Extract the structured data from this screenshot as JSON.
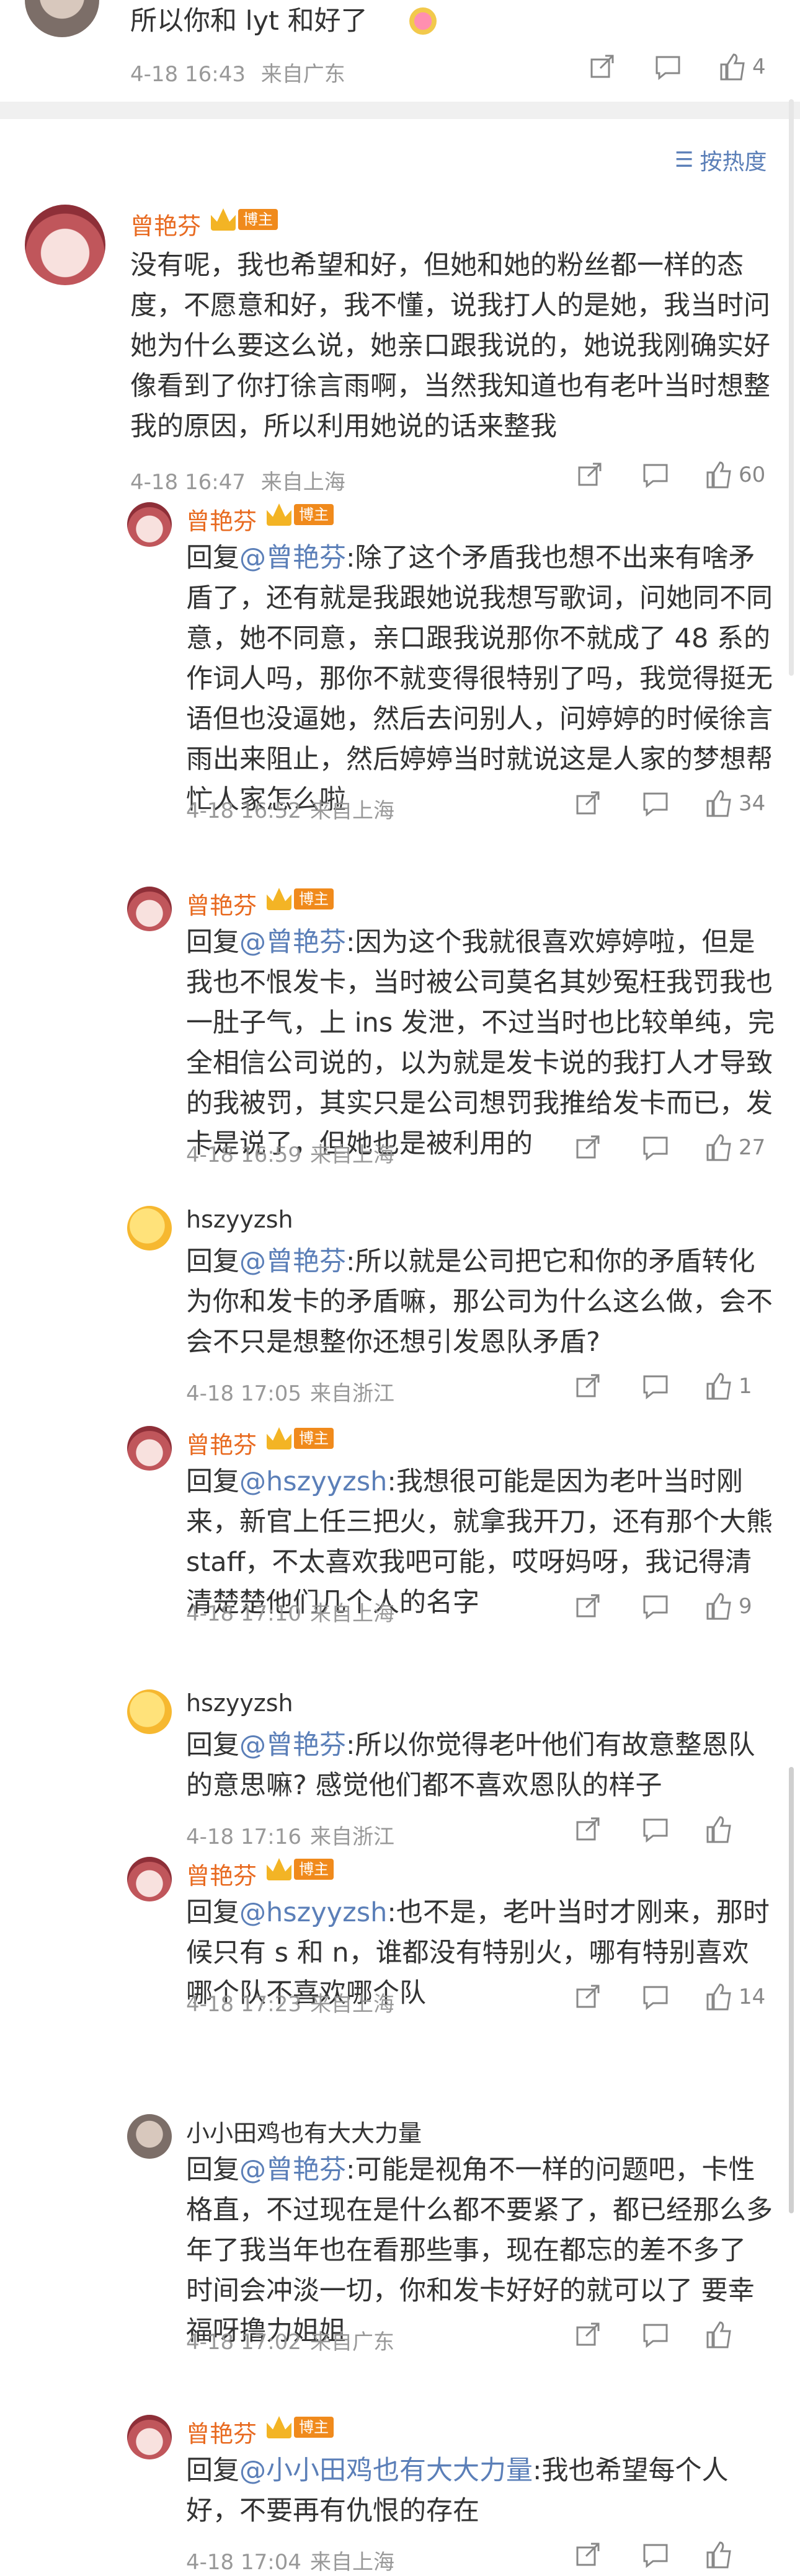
{
  "top_comment": {
    "text": "所以你和 lyt 和好了",
    "time": "4-18 16:43",
    "location": "来自广东",
    "likes": "4"
  },
  "sort": {
    "label": "按热度"
  },
  "badge_label": "博主",
  "main_comment": {
    "user": "曾艳芬",
    "text": "没有呢，我也希望和好，但她和她的粉丝都一样的态度，不愿意和好，我不懂，说我打人的是她，我当时问她为什么要这么说，她亲口跟我说的，她说我刚确实好像看到了你打徐言雨啊，当然我知道也有老叶当时想整我的原因，所以利用她说的话来整我",
    "time": "4-18 16:47",
    "location": "来自上海",
    "likes": "60"
  },
  "replies": [
    {
      "user": "曾艳芬",
      "is_author": true,
      "prefix": "回复",
      "mention": "@曾艳芬",
      "text": ":除了这个矛盾我也想不出来有啥矛盾了，还有就是我跟她说我想写歌词，问她同不同意，她不同意，亲口跟我说那你不就成了 48 系的作词人吗，那你不就变得很特别了吗，我觉得挺无语但也没逼她，然后去问别人，问婷婷的时候徐言雨出来阻止，然后婷婷当时就说这是人家的梦想帮忙人家怎么啦",
      "time": "4-18 16:52",
      "location": "来自上海",
      "likes": "34"
    },
    {
      "user": "曾艳芬",
      "is_author": true,
      "prefix": "回复",
      "mention": "@曾艳芬",
      "text": ":因为这个我就很喜欢婷婷啦，但是我也不恨发卡，当时被公司莫名其妙冤枉我罚我也一肚子气，上 ins 发泄，不过当时也比较单纯，完全相信公司说的，以为就是发卡说的我打人才导致的我被罚，其实只是公司想罚我推给发卡而已，发卡是说了，但她也是被利用的",
      "time": "4-18 16:59",
      "location": "来自上海",
      "likes": "27"
    },
    {
      "user": "hszyyzsh",
      "is_author": false,
      "prefix": "回复",
      "mention": "@曾艳芬",
      "text": ":所以就是公司把它和你的矛盾转化为你和发卡的矛盾嘛，那公司为什么这么做，会不会不只是想整你还想引发恩队矛盾?",
      "time": "4-18 17:05",
      "location": "来自浙江",
      "likes": "1"
    },
    {
      "user": "曾艳芬",
      "is_author": true,
      "prefix": "回复",
      "mention": "@hszyyzsh",
      "text": ":我想很可能是因为老叶当时刚来，新官上任三把火，就拿我开刀，还有那个大熊 staff，不太喜欢我吧可能，哎呀妈呀，我记得清清楚楚他们几个人的名字",
      "time": "4-18 17:10",
      "location": "来自上海",
      "likes": "9"
    },
    {
      "user": "hszyyzsh",
      "is_author": false,
      "prefix": "回复",
      "mention": "@曾艳芬",
      "text": ":所以你觉得老叶他们有故意整恩队的意思嘛? 感觉他们都不喜欢恩队的样子",
      "time": "4-18 17:16",
      "location": "来自浙江",
      "likes": ""
    },
    {
      "user": "曾艳芬",
      "is_author": true,
      "prefix": "回复",
      "mention": "@hszyyzsh",
      "text": ":也不是，老叶当时才刚来，那时候只有 s 和 n，谁都没有特别火，哪有特别喜欢哪个队不喜欢哪个队",
      "time": "4-18 17:23",
      "location": "来自上海",
      "likes": "14"
    },
    {
      "user": "小小田鸡也有大大力量",
      "is_author": false,
      "prefix": "回复",
      "mention": "@曾艳芬",
      "text": ":可能是视角不一样的问题吧，卡性格直，不过现在是什么都不要紧了，都已经那么多年了我当年也在看那些事，现在都忘的差不多了 时间会冲淡一切，你和发卡好好的就可以了 要幸福呀撸力姐姐",
      "time": "4-18 17:02",
      "location": "来自广东",
      "likes": ""
    },
    {
      "user": "曾艳芬",
      "is_author": true,
      "prefix": "回复",
      "mention": "@小小田鸡也有大大力量",
      "text": ":我也希望每个人好，不要再有仇恨的存在",
      "time": "4-18 17:04",
      "location": "来自上海",
      "likes": ""
    }
  ],
  "colors": {
    "name": "#e86a20",
    "mention": "#5b7fb8",
    "meta": "#999999",
    "badge": "#f08a1c"
  }
}
